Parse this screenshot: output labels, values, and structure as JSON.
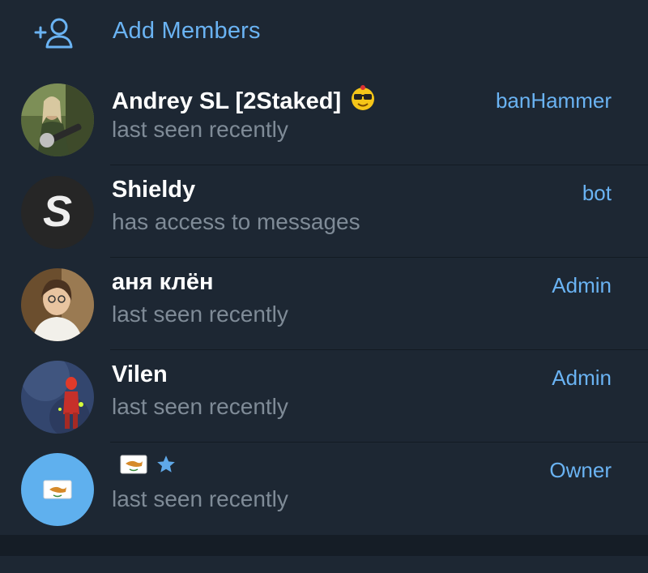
{
  "add_members": {
    "label": "Add Members",
    "icon": "add-user-icon"
  },
  "members": [
    {
      "name": "Andrey SL [2Staked]",
      "status": "last seen recently",
      "role": "banHammer",
      "badge_icon": "sunglasses-emoji-icon"
    },
    {
      "name": "Shieldy",
      "status": "has access to messages",
      "role": "bot",
      "avatar_letter": "S"
    },
    {
      "name": "аня клён",
      "status": "last seen recently",
      "role": "Admin"
    },
    {
      "name": "Vilen",
      "status": "last seen recently",
      "role": "Admin"
    },
    {
      "name": "",
      "status": "last seen recently",
      "role": "Owner",
      "name_icons": [
        "cyprus-flag-icon",
        "star-icon"
      ]
    }
  ],
  "colors": {
    "background": "#1d2733",
    "accent": "#6ab3f3",
    "secondary_text": "#7f8b97",
    "divider": "#131b23",
    "owner_avatar": "#5fb0ee"
  }
}
